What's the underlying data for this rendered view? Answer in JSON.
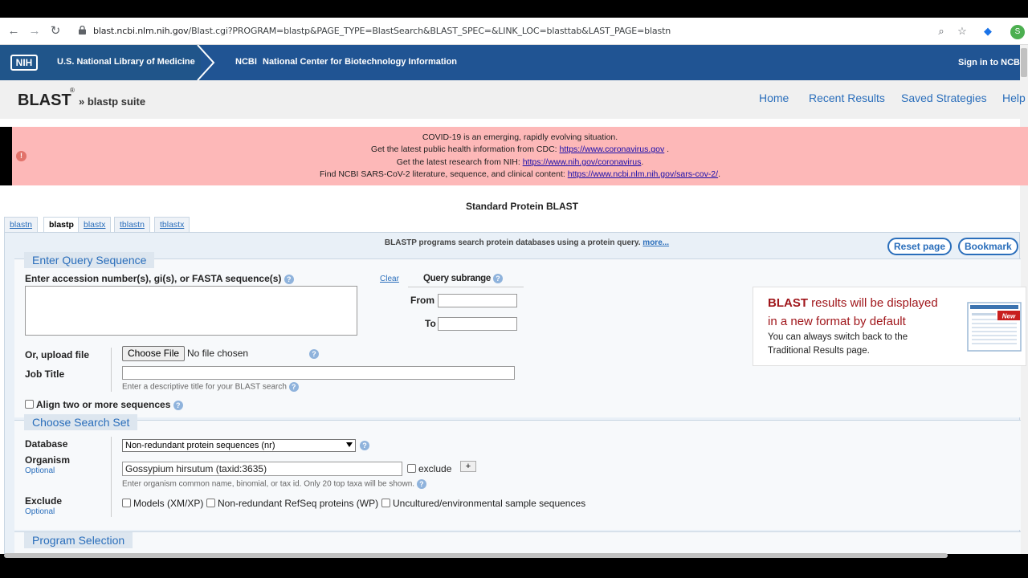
{
  "browser": {
    "url_host": "blast.ncbi.nlm.nih.gov",
    "url_path": "/Blast.cgi?PROGRAM=blastp&PAGE_TYPE=BlastSearch&BLAST_SPEC=&LINK_LOC=blasttab&LAST_PAGE=blastn",
    "avatar_letter": "S"
  },
  "nih": {
    "logo": "NIH",
    "library": "U.S. National Library of Medicine",
    "ncbi": "NCBI",
    "ncbi_name": "National Center for Biotechnology Information",
    "signin": "Sign in to NCBI"
  },
  "header": {
    "title": "BLAST",
    "reg": "®",
    "suite": "» blastp suite",
    "links": [
      "Home",
      "Recent Results",
      "Saved Strategies",
      "Help"
    ]
  },
  "covid": {
    "line1": "COVID-19 is an emerging, rapidly evolving situation.",
    "line2_text": "Get the latest public health information from CDC: ",
    "line2_link": "https://www.coronavirus.gov",
    "line2_tail": " .",
    "line3_text": "Get the latest research from NIH: ",
    "line3_link": "https://www.nih.gov/coronavirus",
    "line3_tail": ".",
    "line4_text": "Find NCBI SARS-CoV-2 literature, sequence, and clinical content: ",
    "line4_link": "https://www.ncbi.nlm.nih.gov/sars-cov-2/",
    "line4_tail": "."
  },
  "main": {
    "title": "Standard Protein BLAST",
    "tabs": [
      "blastn",
      "blastp",
      "blastx",
      "tblastn",
      "tblastx"
    ],
    "description": "BLASTP programs search protein databases using a protein query.",
    "more": "more...",
    "reset": "Reset page",
    "bookmark": "Bookmark"
  },
  "query": {
    "legend": "Enter Query Sequence",
    "label": "Enter accession number(s), gi(s), or FASTA sequence(s)",
    "clear": "Clear",
    "subrange": "Query subrange",
    "from": "From",
    "to": "To",
    "upload_label": "Or, upload file",
    "choose_file": "Choose File",
    "no_file": "No file chosen",
    "job_title": "Job Title",
    "job_hint": "Enter a descriptive title for your BLAST search",
    "align_two": "Align two or more sequences"
  },
  "search_set": {
    "legend": "Choose Search Set",
    "database_label": "Database",
    "database_value": "Non-redundant protein sequences (nr)",
    "organism_label": "Organism",
    "optional": "Optional",
    "organism_value": "Gossypium hirsutum (taxid:3635)",
    "exclude_checkbox": "exclude",
    "plus": "+",
    "organism_hint": "Enter organism common name, binomial, or tax id. Only 20 top taxa will be shown.",
    "exclude_label": "Exclude",
    "exclude_opts": [
      "Models (XM/XP)",
      "Non-redundant RefSeq proteins (WP)",
      "Uncultured/environmental sample sequences"
    ]
  },
  "program": {
    "legend": "Program Selection"
  },
  "promo": {
    "line1_brand": "BLAST",
    "line1_rest": " results will be displayed",
    "line2": "in a new format by default",
    "line3": "You can always switch back to the",
    "line4": "Traditional Results page.",
    "badge": "New"
  }
}
